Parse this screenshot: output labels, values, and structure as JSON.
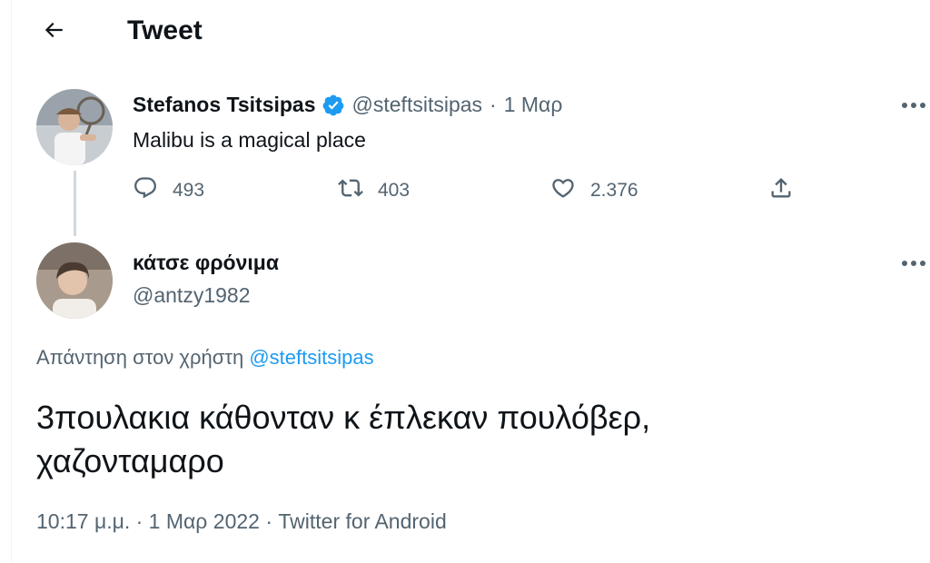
{
  "header": {
    "title": "Tweet"
  },
  "parent_tweet": {
    "display_name": "Stefanos Tsitsipas",
    "handle": "@steftsitsipas",
    "separator": "·",
    "date": "1 Μαρ",
    "text": "Malibu is a magical place",
    "reply_count": "493",
    "retweet_count": "403",
    "like_count": "2.376"
  },
  "reply_tweet": {
    "display_name": "κάτσε φρόνιμα",
    "handle": "@antzy1982",
    "replying_to_label": "Απάντηση στον χρήστη",
    "replying_to_mention": "@steftsitsipas",
    "text_line1": "3πουλακια κάθονταν κ έπλεκαν πουλόβερ,",
    "text_line2": "χαζονταμαρο",
    "meta": "10:17 μ.μ. · 1 Μαρ 2022 · Twitter for Android"
  },
  "icons": {
    "back": "arrow-left-icon",
    "verified": "verified-badge-icon",
    "more": "more-horizontal-icon",
    "reply": "reply-bubble-icon",
    "retweet": "retweet-icon",
    "like": "heart-icon",
    "share": "share-icon"
  },
  "colors": {
    "text": "#0f1419",
    "muted": "#536471",
    "accent": "#1d9bf0",
    "border": "#eff3f4"
  }
}
